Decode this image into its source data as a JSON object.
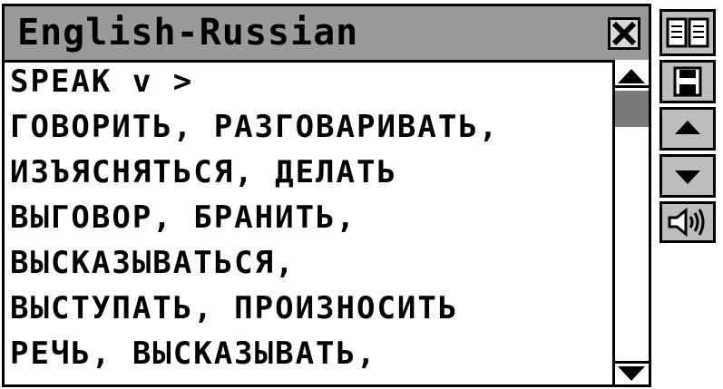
{
  "window": {
    "title": "English-Russian"
  },
  "entry": {
    "lines": [
      "SPEAK v >",
      "ГОВОРИТЬ, РАЗГОВАРИВАТЬ,",
      "ИЗЪЯСНЯТЬСЯ, ДЕЛАТЬ",
      "ВЫГОВОР, БРАНИТЬ,",
      "ВЫСКАЗЫВАТЬСЯ,",
      "ВЫСТУПАТЬ, ПРОИЗНОСИТЬ",
      "РЕЧЬ, ВЫСКАЗЫВАТЬ,"
    ]
  },
  "toolbar": {
    "icons": [
      "book-icon",
      "save-icon",
      "arrow-up-icon",
      "arrow-down-icon",
      "speaker-icon"
    ]
  },
  "colors": {
    "titlebar": "#9a9a9a",
    "side_button": "#bdbdbd",
    "scroll_thumb": "#7a7a7a"
  }
}
